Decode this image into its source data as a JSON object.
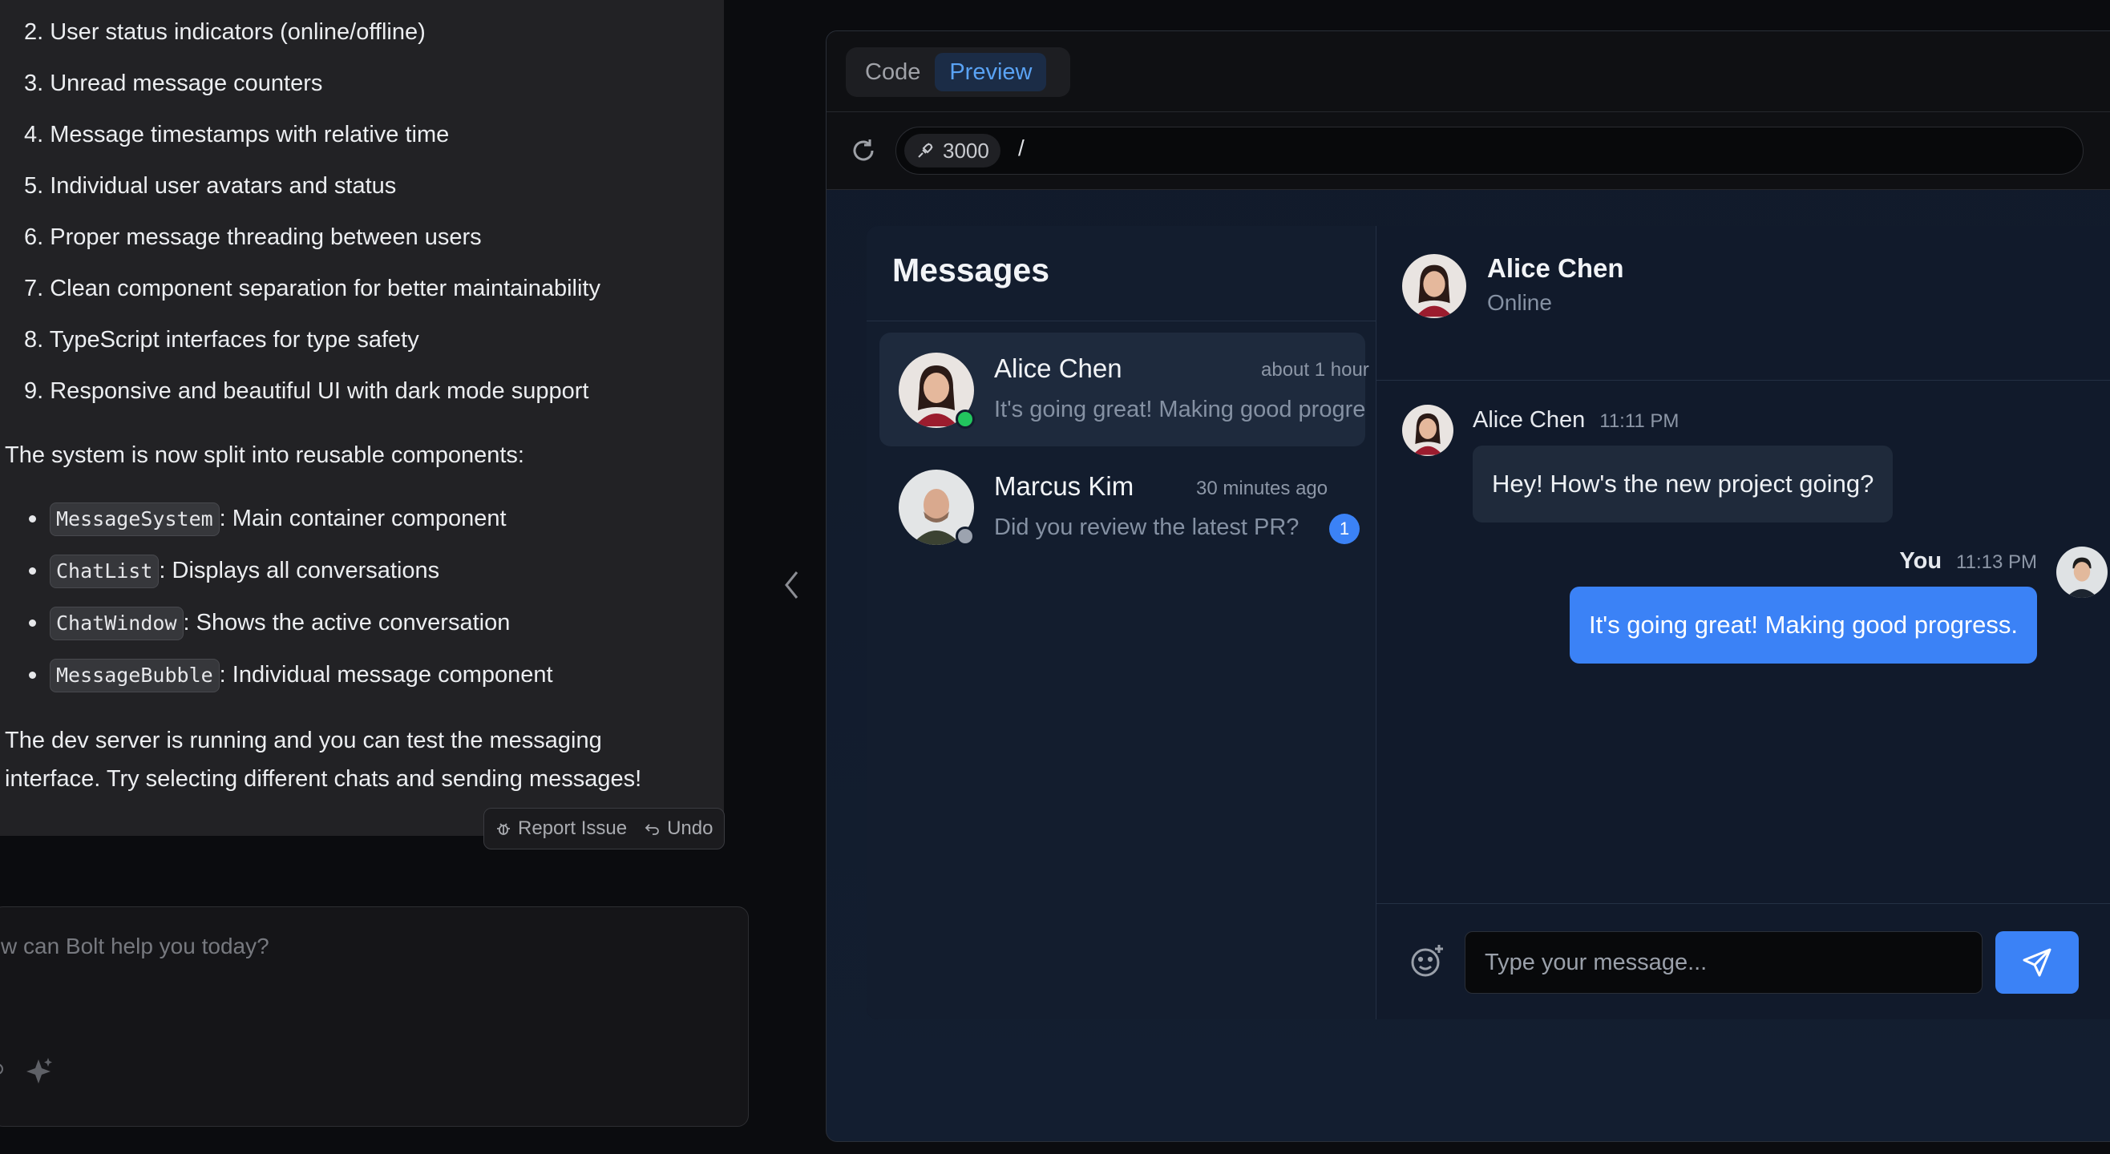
{
  "bolt_chat": {
    "steps": [
      "2. User status indicators (online/offline)",
      "3. Unread message counters",
      "4. Message timestamps with relative time",
      "5. Individual user avatars and status",
      "6. Proper message threading between users",
      "7. Clean component separation for better maintainability",
      "8. TypeScript interfaces for type safety",
      "9. Responsive and beautiful UI with dark mode support"
    ],
    "components_intro": "The system is now split into reusable components:",
    "components": [
      {
        "code": "MessageSystem",
        "desc": ": Main container component"
      },
      {
        "code": "ChatList",
        "desc": ": Displays all conversations"
      },
      {
        "code": "ChatWindow",
        "desc": ": Shows the active conversation"
      },
      {
        "code": "MessageBubble",
        "desc": ": Individual message component"
      }
    ],
    "closing_line1": "The dev server is running and you can test the messaging",
    "closing_line2": "interface. Try selecting different chats and sending messages!",
    "report_issue": "Report Issue",
    "undo": "Undo",
    "prompt_placeholder": "w can Bolt help you today?"
  },
  "preview": {
    "tabs": [
      "Code",
      "Preview"
    ],
    "active_tab": "Preview",
    "port": "3000",
    "path": "/"
  },
  "messenger": {
    "title": "Messages",
    "chats": [
      {
        "name": "Alice Chen",
        "time": "about 1 hour",
        "last": "It's going great! Making good progre",
        "status": "online",
        "unread": ""
      },
      {
        "name": "Marcus Kim",
        "time": "30 minutes ago",
        "last": "Did you review the latest PR?",
        "status": "offline",
        "unread": "1"
      }
    ],
    "active": {
      "name": "Alice Chen",
      "status": "Online"
    },
    "messages": [
      {
        "sender": "Alice Chen",
        "time": "11:11 PM",
        "text": "Hey! How's the new project going?"
      },
      {
        "sender": "You",
        "time": "11:13 PM",
        "text": "It's going great! Making good progress."
      }
    ],
    "input_placeholder": "Type your message...",
    "colors": {
      "accent": "#3b82f6",
      "online": "#22c55e",
      "offline": "#9ca3af"
    }
  }
}
